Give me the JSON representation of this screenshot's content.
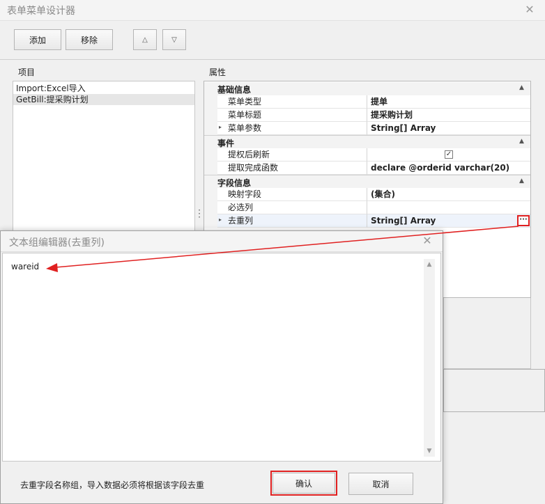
{
  "window": {
    "title": "表单菜单设计器",
    "close": "✕"
  },
  "toolbar": {
    "add_label": "添加",
    "remove_label": "移除",
    "up_label": "△",
    "down_label": "▽"
  },
  "items_panel": {
    "label": "项目",
    "items": [
      {
        "label": "Import:Excel导入"
      },
      {
        "label": "GetBill:提采购计划"
      }
    ]
  },
  "props_panel": {
    "label": "属性",
    "categories": [
      {
        "name": "基础信息",
        "rows": [
          {
            "name": "菜单类型",
            "value": "提单"
          },
          {
            "name": "菜单标题",
            "value": "提采购计划"
          },
          {
            "name": "菜单参数",
            "value": "String[] Array"
          }
        ]
      },
      {
        "name": "事件",
        "rows": [
          {
            "name": "提权后刷新",
            "value": "✓"
          },
          {
            "name": "提取完成函数",
            "value": "declare @orderid varchar(20)"
          }
        ]
      },
      {
        "name": "字段信息",
        "rows": [
          {
            "name": "映射字段",
            "value": "(集合)"
          },
          {
            "name": "必选列",
            "value": ""
          },
          {
            "name": "去重列",
            "value": "String[] Array"
          }
        ]
      }
    ],
    "ellipsis": "···",
    "collapse_glyph": "▲",
    "expand_glyph": "▸"
  },
  "editor_dialog": {
    "title": "文本组编辑器(去重列)",
    "close": "✕",
    "content": "wareid",
    "scroll_up": "▲",
    "scroll_down": "▼",
    "hint": "去重字段名称组，导入数据必须将根据该字段去重",
    "confirm_label": "确认",
    "cancel_label": "取消"
  },
  "colors": {
    "highlight_red": "#e02020",
    "selection_gray": "#e6e6e6",
    "row_highlight": "#eef3fb"
  }
}
